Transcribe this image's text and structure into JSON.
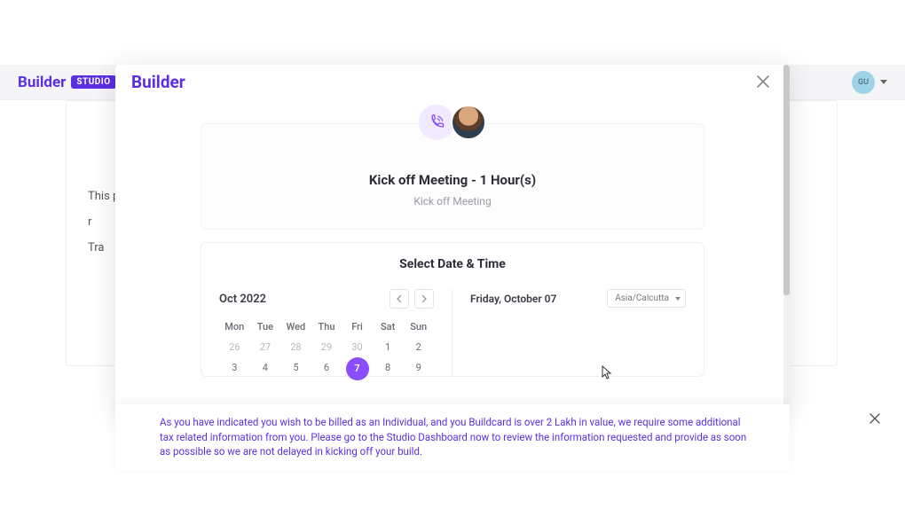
{
  "header": {
    "brand_main": "Builder",
    "brand_badge": "STUDIO",
    "avatar_initials": "GU"
  },
  "background_card": {
    "line1": "This p",
    "line2": "r",
    "line3": "Tra"
  },
  "modal": {
    "brand": "Builder",
    "meeting": {
      "title": "Kick off Meeting - 1 Hour(s)",
      "subtitle": "Kick off Meeting"
    },
    "datetime": {
      "heading": "Select Date & Time",
      "month_label": "Oct  2022",
      "weekdays": [
        "Mon",
        "Tue",
        "Wed",
        "Thu",
        "Fri",
        "Sat",
        "Sun"
      ],
      "rows": [
        [
          {
            "n": "26",
            "in": false
          },
          {
            "n": "27",
            "in": false
          },
          {
            "n": "28",
            "in": false
          },
          {
            "n": "29",
            "in": false
          },
          {
            "n": "30",
            "in": false
          },
          {
            "n": "1",
            "in": true
          },
          {
            "n": "2",
            "in": true
          }
        ],
        [
          {
            "n": "3",
            "in": true
          },
          {
            "n": "4",
            "in": true
          },
          {
            "n": "5",
            "in": true
          },
          {
            "n": "6",
            "in": true
          },
          {
            "n": "7",
            "in": true,
            "sel": true
          },
          {
            "n": "8",
            "in": true
          },
          {
            "n": "9",
            "in": true
          }
        ]
      ],
      "selected_date_label": "Friday, October 07",
      "timezone": "Asia/Calcutta"
    }
  },
  "notice": {
    "text": "As you have indicated you wish to be billed as an Individual, and you Buildcard is over 2 Lakh in value, we require some additional tax related information from you. Please go to the Studio Dashboard now to review the information requested and provide as soon as possible so we are not delayed in kicking off your build."
  },
  "colors": {
    "brand_purple": "#5b2fe3",
    "accent_purple": "#8a4dff"
  }
}
